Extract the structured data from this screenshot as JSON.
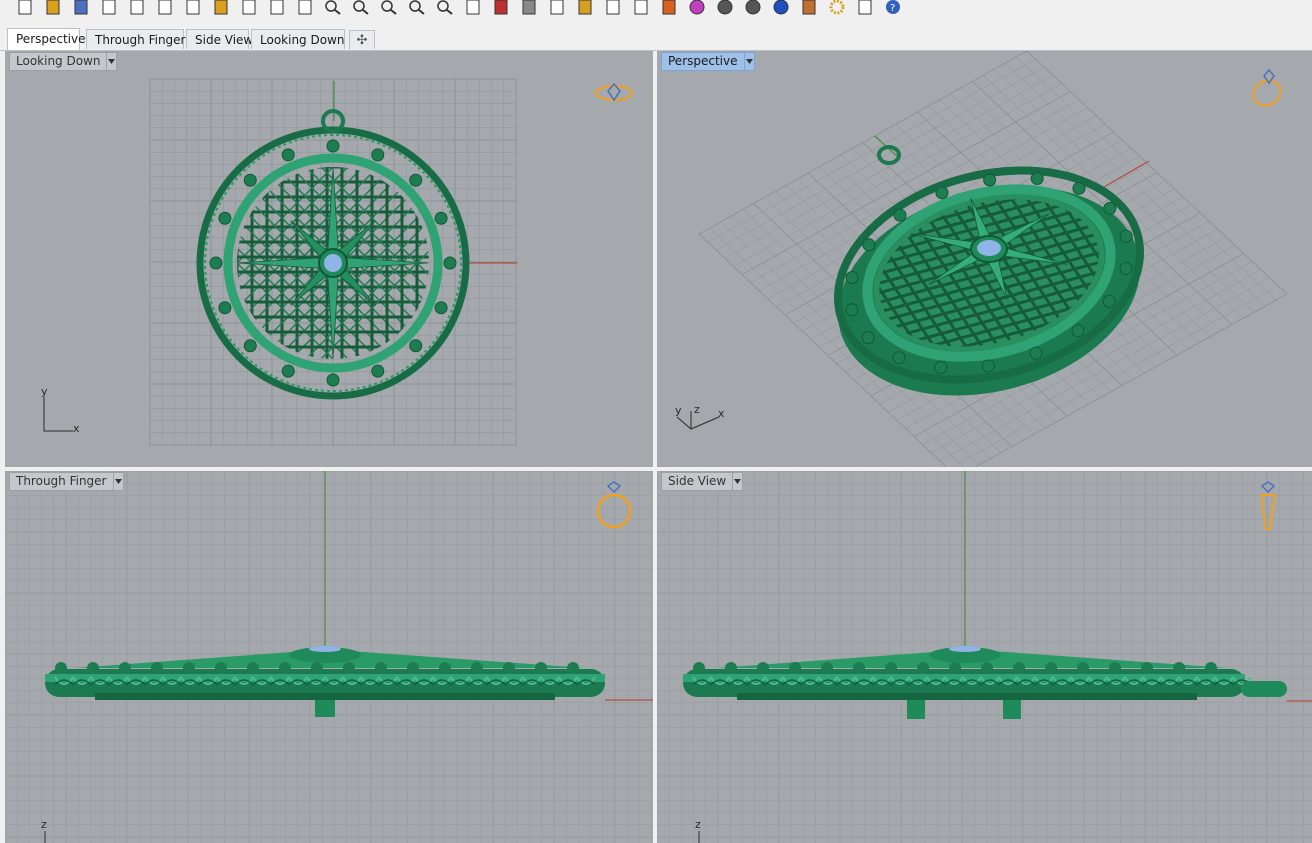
{
  "toolbar": {
    "icons": [
      "new-icon",
      "open-icon",
      "save-icon",
      "print-icon",
      "import-icon",
      "cut-icon",
      "copy-icon",
      "paste-icon",
      "undo-icon",
      "pan-icon",
      "rotate-view-icon",
      "zoom-icon",
      "zoom-window-icon",
      "zoom-extents-icon",
      "zoom-selected-icon",
      "zoom-target-icon",
      "four-viewports-icon",
      "car-icon",
      "layout-icon",
      "clock-icon",
      "shapes-icon",
      "light-icon",
      "lock-icon",
      "layers-icon",
      "color-wheel-icon",
      "shaded-sphere-icon",
      "rendered-sphere-icon",
      "blue-sphere-icon",
      "pencil-icon",
      "settings-gear-icon",
      "dimension-icon",
      "help-icon"
    ]
  },
  "tabs": {
    "items": [
      "Perspective",
      "Through Finger",
      "Side View",
      "Looking Down"
    ],
    "active": "Perspective"
  },
  "viewports": {
    "top_left": {
      "label": "Looking Down",
      "axis_x": "x",
      "axis_y": "y"
    },
    "top_right": {
      "label": "Perspective",
      "axis_x": "x",
      "axis_y": "y",
      "axis_z": "z"
    },
    "bottom_left": {
      "label": "Through Finger",
      "axis_z": "z"
    },
    "bottom_right": {
      "label": "Side View",
      "axis_z": "z"
    }
  },
  "colors": {
    "viewport_bg": "#a5a9ad",
    "model_green": "#1f8a5a",
    "grid_line": "#8e9396",
    "x_axis": "#b33a2a",
    "y_axis": "#2e8b2e",
    "gem": "#8fb4e6",
    "ring_icon": "#f0a020",
    "active_label": "#9fc0e8"
  }
}
